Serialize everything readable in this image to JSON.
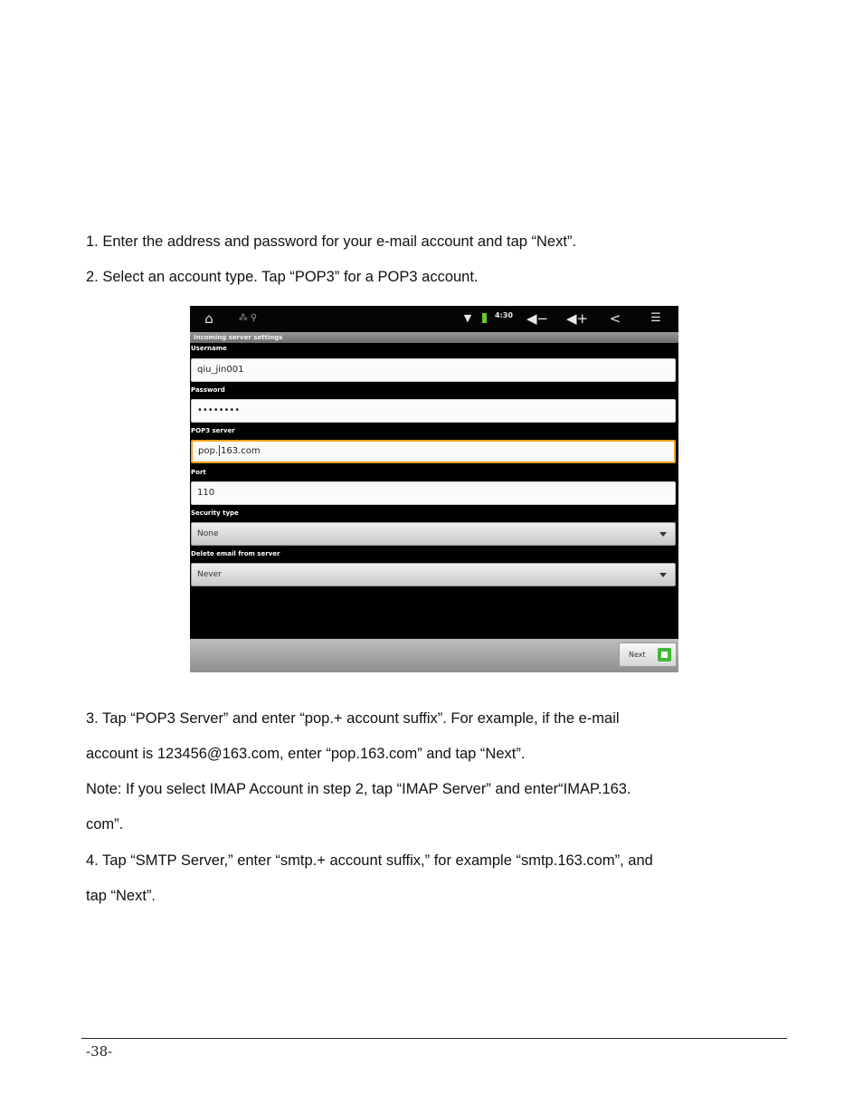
{
  "paragraphs": {
    "step1": "1. Enter the address and password for your e-mail account and tap “Next”.",
    "step2": "2. Select an account type. Tap “POP3” for a POP3 account.",
    "step3_line1": "3. Tap “POP3 Server” and enter “pop.+ account suffix”. For example, if the e-mail",
    "step3_line2": "account is 123456@163.com, enter “pop.163.com” and tap “Next”.",
    "note_line1": "Note: If you select IMAP Account in step 2, tap “IMAP Server” and enter“IMAP.163.",
    "note_line2": "com”.",
    "step4_line1": "4. Tap “SMTP Server,” enter “smtp.+ account suffix,” for example “smtp.163.com”, and",
    "step4_line2": "tap “Next”."
  },
  "screenshot": {
    "status_time": "4:30",
    "header_title": "Incoming server settings",
    "username_label": "Username",
    "username_value": "qiu_jin001",
    "password_label": "Password",
    "password_value": "••••••••",
    "pop3_label": "POP3 server",
    "pop3_value_before_cursor": "pop.",
    "pop3_value_after_cursor": "163.com",
    "port_label": "Port",
    "port_value": "110",
    "security_label": "Security type",
    "security_value": "None",
    "delete_label": "Delete email from server",
    "delete_value": "Never",
    "next_label": "Next",
    "icons": {
      "home": "home-icon",
      "usb": "usb-icon",
      "wifi": "wifi-icon",
      "volume_down": "volume-down-icon",
      "volume_up": "volume-up-icon",
      "back": "back-icon",
      "menu": "menu-icon"
    }
  },
  "footer": {
    "page_number": "-38-"
  }
}
